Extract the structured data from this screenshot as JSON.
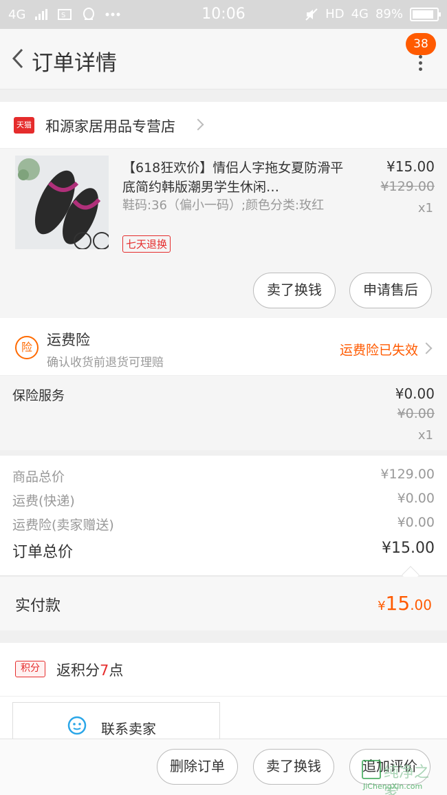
{
  "status_bar": {
    "network_left": "4G",
    "time": "10:06",
    "hd": "HD",
    "network_right": "4G",
    "battery": "89%"
  },
  "header": {
    "title": "订单详情",
    "badge": "38"
  },
  "store": {
    "name": "和源家居用品专营店",
    "platform_badge": "天猫"
  },
  "product": {
    "title": "【618狂欢价】情侣人字拖女夏防滑平底简约韩版潮男学生休闲…",
    "sku": "鞋码:36（偏小一码）;颜色分类:玫红",
    "tag": "七天退换",
    "price": "¥15.00",
    "original_price": "¥129.00",
    "quantity": "x1",
    "buttons": [
      "卖了换钱",
      "申请售后"
    ]
  },
  "freight_insurance": {
    "icon_text": "险",
    "title": "运费险",
    "subtitle": "确认收货前退货可理赔",
    "status": "运费险已失效"
  },
  "insurance_service": {
    "label": "保险服务",
    "price": "¥0.00",
    "original_price": "¥0.00",
    "quantity": "x1"
  },
  "summary": {
    "rows": [
      {
        "label": "商品总价",
        "value": "¥129.00"
      },
      {
        "label": "运费(快递)",
        "value": "¥0.00"
      },
      {
        "label": "运费险(卖家赠送)",
        "value": "¥0.00"
      }
    ],
    "total_label": "订单总价",
    "total_value": "¥15.00"
  },
  "payment": {
    "label": "实付款",
    "currency": "¥",
    "integer": "15",
    "decimal": ".00"
  },
  "points": {
    "icon_text": "积分",
    "prefix": "返积分",
    "number": "7",
    "suffix": "点"
  },
  "contact": {
    "label": "联系卖家"
  },
  "bottom_bar": {
    "buttons": [
      "删除订单",
      "卖了换钱",
      "追加评价"
    ]
  },
  "watermark": {
    "cn": "纯净之家",
    "en": "JiChengXin.com"
  },
  "colors": {
    "accent_orange": "#ff5a00",
    "tmall_red": "#e52c2c",
    "chat_blue": "#2aa6e8"
  }
}
